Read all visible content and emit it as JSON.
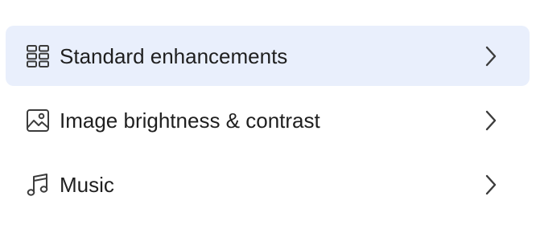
{
  "menu": {
    "items": [
      {
        "label": "Standard enhancements",
        "icon": "grid-icon",
        "selected": true
      },
      {
        "label": "Image brightness & contrast",
        "icon": "image-icon",
        "selected": false
      },
      {
        "label": "Music",
        "icon": "music-note-icon",
        "selected": false
      }
    ]
  },
  "colors": {
    "selected_background": "#e9effc",
    "text": "#1f1f1f",
    "icon": "#3c3c3c"
  }
}
